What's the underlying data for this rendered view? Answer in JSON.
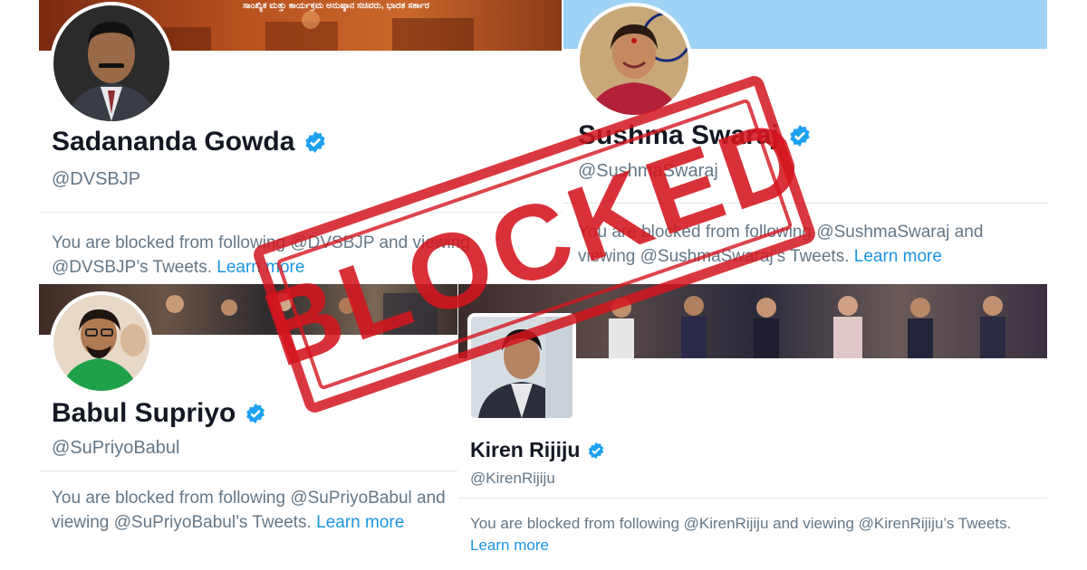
{
  "colors": {
    "link": "#1b95e0",
    "verified": "#1da1f2",
    "handle": "#657786",
    "name": "#141823",
    "stamp": "#d4151e",
    "sky_banner": "#9fd3f5"
  },
  "icons": {
    "verified": "verified-badge-icon"
  },
  "banner_text": "ಸಾಂಖ್ಯಿಕ ಮತ್ತು ಕಾರ್ಯಕ್ರಮ ಅನುಷ್ಠಾನ ಸಚಿವರು, ಭಾರತ ಸರ್ಕಾರ",
  "stamp_text": "BLOCKED",
  "profiles": {
    "gowda": {
      "name": "Sadananda Gowda",
      "handle": "@DVSBJP",
      "blocked_text": "You are blocked from following @DVSBJP and viewing @DVSBJP’s Tweets.",
      "learn_more": "Learn more"
    },
    "sushma": {
      "name": "Sushma Swaraj",
      "handle": "@SushmaSwaraj",
      "blocked_text": "You are blocked from following @SushmaSwaraj and viewing @SushmaSwaraj’s Tweets.",
      "learn_more": "Learn more"
    },
    "babul": {
      "name": "Babul Supriyo",
      "handle": "@SuPriyoBabul",
      "blocked_text": "You are blocked from following @SuPriyoBabul and viewing @SuPriyoBabul’s Tweets.",
      "learn_more": "Learn more"
    },
    "kiren": {
      "name": "Kiren Rijiju",
      "handle": "@KirenRijiju",
      "blocked_text": "You are blocked from following @KirenRijiju and viewing @KirenRijiju’s Tweets.",
      "learn_more": "Learn more"
    }
  }
}
